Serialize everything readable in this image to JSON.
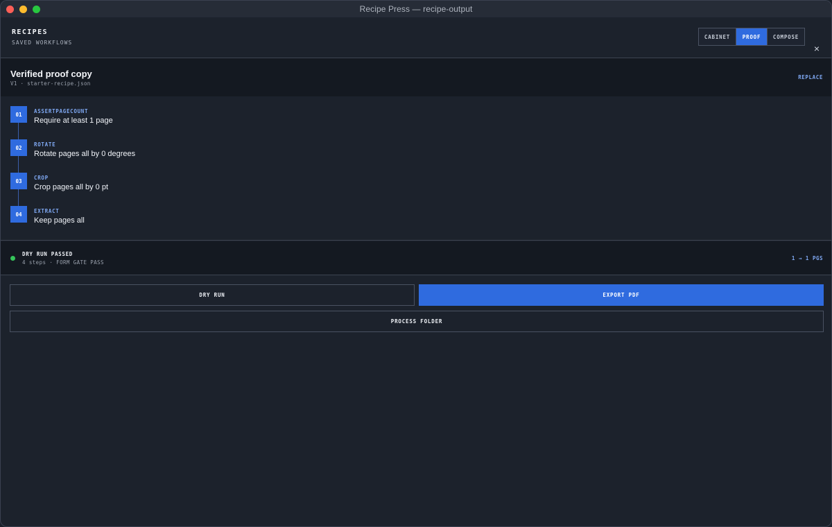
{
  "window": {
    "title": "Recipe Press — recipe-output"
  },
  "header": {
    "title": "RECIPES",
    "subtitle": "SAVED WORKFLOWS",
    "tabs": [
      {
        "label": "CABINET",
        "active": false
      },
      {
        "label": "PROOF",
        "active": true
      },
      {
        "label": "COMPOSE",
        "active": false
      }
    ],
    "close_icon": "×"
  },
  "recipe": {
    "name": "Verified proof copy",
    "meta": "V1 · starter-recipe.json",
    "replace_label": "REPLACE"
  },
  "steps": [
    {
      "num": "01",
      "op": "ASSERTPAGECOUNT",
      "desc": "Require at least 1 page"
    },
    {
      "num": "02",
      "op": "ROTATE",
      "desc": "Rotate pages all by 0 degrees"
    },
    {
      "num": "03",
      "op": "CROP",
      "desc": "Crop pages all by 0 pt"
    },
    {
      "num": "04",
      "op": "EXTRACT",
      "desc": "Keep pages all"
    }
  ],
  "status": {
    "label": "DRY RUN PASSED",
    "sub": "4 steps · FORM GATE PASS",
    "pages": "1 → 1 PGS",
    "color": "#35c45a"
  },
  "actions": {
    "dry_run": "DRY RUN",
    "export": "EXPORT PDF",
    "process_folder": "PROCESS FOLDER"
  },
  "colors": {
    "accent": "#2f6bdf",
    "accent_text": "#7fa8f2",
    "background": "#1c222c"
  }
}
